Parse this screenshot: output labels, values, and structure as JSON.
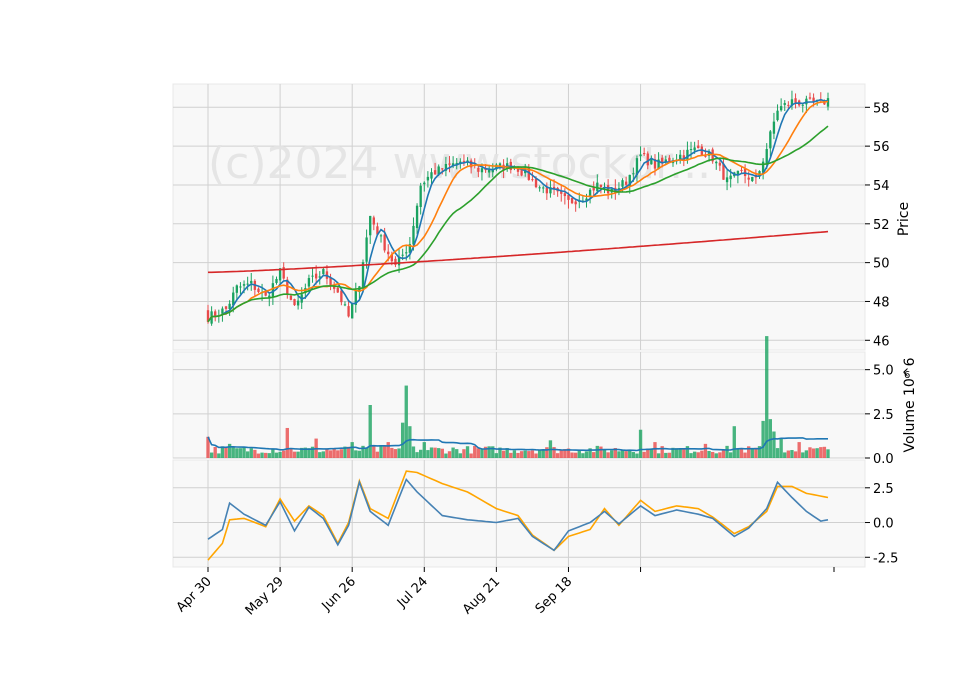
{
  "watermark": "(c)2024 www.stockdr...",
  "colors": {
    "up": "#1aa260",
    "down": "#e84a4a",
    "ma_blue": "#1f77b4",
    "ma_orange": "#ff7f0e",
    "ma_green": "#2ca02c",
    "ma_red": "#d62728",
    "vol_ma": "#1f77b4",
    "osc_orange": "#ffa500",
    "osc_blue": "#4682b4",
    "panel_bg": "#f8f8f8",
    "grid": "#d0d0d0"
  },
  "chart_data": {
    "type": "candlestick",
    "x_ticks": [
      "Apr 30",
      "May 29",
      "Jun 26",
      "Jul 24",
      "Aug 21",
      "Sep 18"
    ],
    "price_panel": {
      "ylabel": "Price",
      "ylim": [
        45.5,
        59.2
      ],
      "yticks": [
        "46",
        "48",
        "50",
        "52",
        "54",
        "56",
        "58"
      ],
      "anchor_closes": [
        {
          "d": 0,
          "c": 47.2
        },
        {
          "d": 5,
          "c": 47.6
        },
        {
          "d": 8,
          "c": 48.7
        },
        {
          "d": 12,
          "c": 48.9
        },
        {
          "d": 16,
          "c": 48.2
        },
        {
          "d": 20,
          "c": 49.5
        },
        {
          "d": 24,
          "c": 47.6
        },
        {
          "d": 28,
          "c": 49.0
        },
        {
          "d": 32,
          "c": 49.5
        },
        {
          "d": 36,
          "c": 48.5
        },
        {
          "d": 39,
          "c": 47.2
        },
        {
          "d": 42,
          "c": 49.0
        },
        {
          "d": 45,
          "c": 52.4
        },
        {
          "d": 48,
          "c": 51.2
        },
        {
          "d": 52,
          "c": 49.8
        },
        {
          "d": 56,
          "c": 51.0
        },
        {
          "d": 59,
          "c": 54.0
        },
        {
          "d": 62,
          "c": 54.6
        },
        {
          "d": 66,
          "c": 54.9
        },
        {
          "d": 70,
          "c": 55.2
        },
        {
          "d": 75,
          "c": 54.8
        },
        {
          "d": 80,
          "c": 54.9
        },
        {
          "d": 85,
          "c": 55.0
        },
        {
          "d": 89,
          "c": 54.4
        },
        {
          "d": 92,
          "c": 53.9
        },
        {
          "d": 96,
          "c": 53.6
        },
        {
          "d": 100,
          "c": 53.1
        },
        {
          "d": 104,
          "c": 53.4
        },
        {
          "d": 108,
          "c": 54.0
        },
        {
          "d": 112,
          "c": 53.6
        },
        {
          "d": 116,
          "c": 54.2
        },
        {
          "d": 120,
          "c": 55.5
        },
        {
          "d": 124,
          "c": 55.0
        },
        {
          "d": 128,
          "c": 55.3
        },
        {
          "d": 132,
          "c": 55.6
        },
        {
          "d": 136,
          "c": 55.9
        },
        {
          "d": 140,
          "c": 55.4
        },
        {
          "d": 144,
          "c": 54.2
        },
        {
          "d": 148,
          "c": 54.6
        },
        {
          "d": 152,
          "c": 54.2
        },
        {
          "d": 155,
          "c": 55.9
        },
        {
          "d": 158,
          "c": 57.9
        },
        {
          "d": 162,
          "c": 58.3
        },
        {
          "d": 166,
          "c": 58.2
        },
        {
          "d": 170,
          "c": 58.2
        },
        {
          "d": 172,
          "c": 58.4
        }
      ]
    },
    "volume_panel": {
      "ylabel": "Volume  10^6",
      "ylim": [
        0,
        6.0
      ],
      "yticks": [
        "0.0",
        "2.5",
        "5.0"
      ],
      "spikes": [
        {
          "d": 0,
          "v": 1.2
        },
        {
          "d": 6,
          "v": 0.8
        },
        {
          "d": 22,
          "v": 1.7
        },
        {
          "d": 30,
          "v": 1.1
        },
        {
          "d": 40,
          "v": 0.9
        },
        {
          "d": 45,
          "v": 3.0
        },
        {
          "d": 50,
          "v": 0.9
        },
        {
          "d": 54,
          "v": 2.0
        },
        {
          "d": 55,
          "v": 4.1
        },
        {
          "d": 56,
          "v": 1.8
        },
        {
          "d": 60,
          "v": 0.9
        },
        {
          "d": 95,
          "v": 1.0
        },
        {
          "d": 120,
          "v": 1.6
        },
        {
          "d": 124,
          "v": 0.9
        },
        {
          "d": 138,
          "v": 0.8
        },
        {
          "d": 146,
          "v": 1.8
        },
        {
          "d": 154,
          "v": 2.1
        },
        {
          "d": 155,
          "v": 6.9
        },
        {
          "d": 156,
          "v": 2.2
        },
        {
          "d": 157,
          "v": 1.5
        },
        {
          "d": 159,
          "v": 1.1
        },
        {
          "d": 164,
          "v": 0.9
        }
      ]
    },
    "oscillator_panel": {
      "ylim": [
        -3.2,
        4.5
      ],
      "yticks": [
        "-2.5",
        "0.0",
        "2.5"
      ],
      "orange_anchors": [
        {
          "d": 0,
          "v": -2.7
        },
        {
          "d": 4,
          "v": -1.5
        },
        {
          "d": 6,
          "v": 0.2
        },
        {
          "d": 10,
          "v": 0.3
        },
        {
          "d": 16,
          "v": -0.3
        },
        {
          "d": 20,
          "v": 1.7
        },
        {
          "d": 24,
          "v": 0.1
        },
        {
          "d": 28,
          "v": 1.2
        },
        {
          "d": 32,
          "v": 0.5
        },
        {
          "d": 36,
          "v": -1.5
        },
        {
          "d": 39,
          "v": 0.0
        },
        {
          "d": 42,
          "v": 3.0
        },
        {
          "d": 45,
          "v": 1.0
        },
        {
          "d": 50,
          "v": 0.3
        },
        {
          "d": 55,
          "v": 3.7
        },
        {
          "d": 58,
          "v": 3.6
        },
        {
          "d": 65,
          "v": 2.8
        },
        {
          "d": 72,
          "v": 2.2
        },
        {
          "d": 80,
          "v": 1.0
        },
        {
          "d": 86,
          "v": 0.5
        },
        {
          "d": 90,
          "v": -0.9
        },
        {
          "d": 96,
          "v": -2.0
        },
        {
          "d": 100,
          "v": -1.0
        },
        {
          "d": 106,
          "v": -0.5
        },
        {
          "d": 110,
          "v": 1.0
        },
        {
          "d": 114,
          "v": -0.2
        },
        {
          "d": 120,
          "v": 1.6
        },
        {
          "d": 124,
          "v": 0.8
        },
        {
          "d": 130,
          "v": 1.2
        },
        {
          "d": 136,
          "v": 1.0
        },
        {
          "d": 140,
          "v": 0.4
        },
        {
          "d": 146,
          "v": -0.8
        },
        {
          "d": 150,
          "v": -0.3
        },
        {
          "d": 155,
          "v": 0.8
        },
        {
          "d": 158,
          "v": 2.6
        },
        {
          "d": 162,
          "v": 2.6
        },
        {
          "d": 166,
          "v": 2.1
        },
        {
          "d": 172,
          "v": 1.8
        }
      ],
      "blue_anchors": [
        {
          "d": 0,
          "v": -1.2
        },
        {
          "d": 4,
          "v": -0.5
        },
        {
          "d": 6,
          "v": 1.4
        },
        {
          "d": 10,
          "v": 0.6
        },
        {
          "d": 16,
          "v": -0.2
        },
        {
          "d": 20,
          "v": 1.5
        },
        {
          "d": 24,
          "v": -0.6
        },
        {
          "d": 28,
          "v": 1.1
        },
        {
          "d": 32,
          "v": 0.3
        },
        {
          "d": 36,
          "v": -1.6
        },
        {
          "d": 39,
          "v": -0.2
        },
        {
          "d": 42,
          "v": 2.9
        },
        {
          "d": 45,
          "v": 0.8
        },
        {
          "d": 50,
          "v": -0.2
        },
        {
          "d": 55,
          "v": 3.1
        },
        {
          "d": 58,
          "v": 2.2
        },
        {
          "d": 65,
          "v": 0.5
        },
        {
          "d": 72,
          "v": 0.2
        },
        {
          "d": 80,
          "v": 0.0
        },
        {
          "d": 86,
          "v": 0.3
        },
        {
          "d": 90,
          "v": -1.0
        },
        {
          "d": 96,
          "v": -2.0
        },
        {
          "d": 100,
          "v": -0.6
        },
        {
          "d": 106,
          "v": 0.0
        },
        {
          "d": 110,
          "v": 0.8
        },
        {
          "d": 114,
          "v": -0.1
        },
        {
          "d": 120,
          "v": 1.2
        },
        {
          "d": 124,
          "v": 0.5
        },
        {
          "d": 130,
          "v": 0.9
        },
        {
          "d": 136,
          "v": 0.6
        },
        {
          "d": 140,
          "v": 0.3
        },
        {
          "d": 146,
          "v": -1.0
        },
        {
          "d": 150,
          "v": -0.4
        },
        {
          "d": 155,
          "v": 1.0
        },
        {
          "d": 158,
          "v": 2.9
        },
        {
          "d": 162,
          "v": 1.8
        },
        {
          "d": 166,
          "v": 0.8
        },
        {
          "d": 170,
          "v": 0.1
        },
        {
          "d": 172,
          "v": 0.2
        }
      ]
    }
  }
}
